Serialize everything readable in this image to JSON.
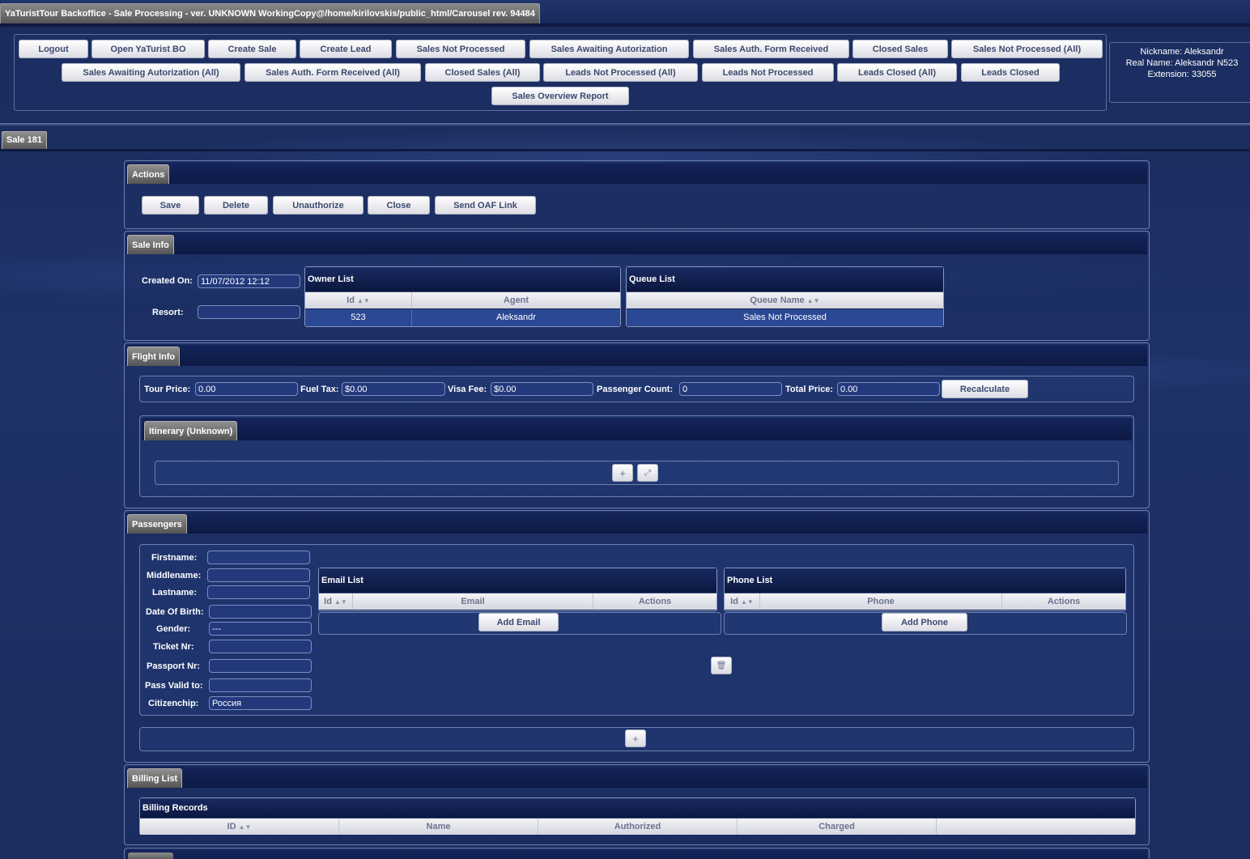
{
  "window": {
    "title": "YaTuristTour Backoffice - Sale Processing - ver. UNKNOWN WorkingCopy@/home/kirilovskis/public_html/Carousel rev. 94484"
  },
  "nav": {
    "row1": [
      "Logout",
      "Open YaTurist BO",
      "Create Sale",
      "Create Lead",
      "Sales Not Processed",
      "Sales Awaiting Autorization",
      "Sales Auth. Form Received",
      "Closed Sales",
      "Sales Not Processed (All)"
    ],
    "row2": [
      "Sales Awaiting Autorization (All)",
      "Sales Auth. Form Received (All)",
      "Closed Sales (All)",
      "Leads Not Processed (All)",
      "Leads Not Processed",
      "Leads Closed (All)",
      "Leads Closed"
    ],
    "row3": [
      "Sales Overview Report"
    ]
  },
  "user": {
    "nickname": "Nickname: Aleksandr",
    "realname": "Real Name: Aleksandr N523",
    "extension": "Extension: 33055"
  },
  "sale_tab": "Sale 181",
  "actions": {
    "title": "Actions",
    "buttons": [
      "Save",
      "Delete",
      "Unauthorize",
      "Close",
      "Send OAF Link"
    ]
  },
  "sale_info": {
    "title": "Sale Info",
    "created_on_label": "Created On:",
    "created_on_value": "11/07/2012 12:12",
    "resort_label": "Resort:",
    "resort_value": "",
    "owner_list": {
      "title": "Owner List",
      "columns": [
        "Id",
        "Agent"
      ],
      "rows": [
        [
          "523",
          "Aleksandr"
        ]
      ]
    },
    "queue_list": {
      "title": "Queue List",
      "columns": [
        "Queue Name"
      ],
      "rows": [
        [
          "Sales Not Processed"
        ]
      ]
    }
  },
  "flight_info": {
    "title": "Flight Info",
    "tour_price_label": "Tour Price:",
    "tour_price": "0.00",
    "fuel_tax_label": "Fuel Tax:",
    "fuel_tax": "$0.00",
    "visa_fee_label": "Visa Fee:",
    "visa_fee": "$0.00",
    "passenger_count_label": "Passenger Count:",
    "passenger_count": "0",
    "total_price_label": "Total Price:",
    "total_price": "0.00",
    "recalculate": "Recalculate",
    "itinerary_title": "Itinerary (Unknown)"
  },
  "passengers": {
    "title": "Passengers",
    "fields": {
      "firstname_label": "Firstname:",
      "firstname": "",
      "middlename_label": "Middlename:",
      "middlename": "",
      "lastname_label": "Lastname:",
      "lastname": "",
      "dob_label": "Date Of Birth:",
      "dob": "",
      "gender_label": "Gender:",
      "gender": "---",
      "ticket_label": "Ticket Nr:",
      "ticket": "",
      "passport_label": "Passport Nr:",
      "passport": "",
      "passvalid_label": "Pass Valid to:",
      "passvalid": "",
      "citizenship_label": "Citizenchip:",
      "citizenship": "Россия"
    },
    "email_list": {
      "title": "Email List",
      "columns": [
        "Id",
        "Email",
        "Actions"
      ],
      "add": "Add Email"
    },
    "phone_list": {
      "title": "Phone List",
      "columns": [
        "Id",
        "Phone",
        "Actions"
      ],
      "add": "Add Phone"
    }
  },
  "billing": {
    "title": "Billing List",
    "grid_title": "Billing Records",
    "columns": [
      "ID",
      "Name",
      "Authorized",
      "Charged"
    ]
  },
  "icons": {
    "add": "+",
    "open": "⤢",
    "trash": "🗑"
  }
}
